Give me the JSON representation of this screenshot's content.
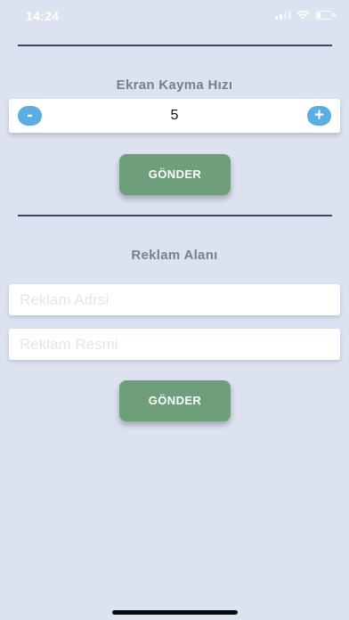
{
  "status_bar": {
    "time": "14:24",
    "battery_level": 0.25
  },
  "scroll_speed": {
    "title": "Ekran Kayma Hızı",
    "decrement_label": "-",
    "value": "5",
    "increment_label": "+",
    "send_label": "GÖNDER"
  },
  "ad_area": {
    "title": "Reklam Alanı",
    "field1_placeholder": "Reklam Adrsi",
    "field2_placeholder": "Reklam Resmi",
    "send_label": "GÖNDER"
  },
  "colors": {
    "background": "#dde2f1",
    "divider": "#3a4a63",
    "stepper_button": "#5aaee4",
    "send_button": "#6f9e7b"
  }
}
